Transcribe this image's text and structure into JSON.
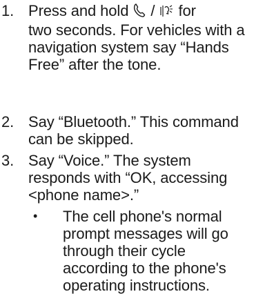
{
  "steps": [
    {
      "number": "1.",
      "text_before_icons": "Press and hold",
      "icon_separator": "/",
      "text_after_icons": "for",
      "lines": [
        "two seconds. For vehicles with a",
        "navigation system say “Hands",
        "Free” after the tone."
      ],
      "icons": [
        "phone-handset-icon",
        "voice-speak-icon"
      ]
    },
    {
      "number": "2.",
      "lines": [
        "Say “Bluetooth.” This command",
        "can be skipped."
      ]
    },
    {
      "number": "3.",
      "lines": [
        "Say “Voice.” The system",
        "responds with “OK, accessing",
        "<phone name>.”"
      ]
    }
  ],
  "bullet": {
    "mark": "•",
    "lines": [
      "The cell phone's normal",
      "prompt messages will go",
      "through their cycle",
      "according to the phone's",
      "operating instructions."
    ]
  }
}
